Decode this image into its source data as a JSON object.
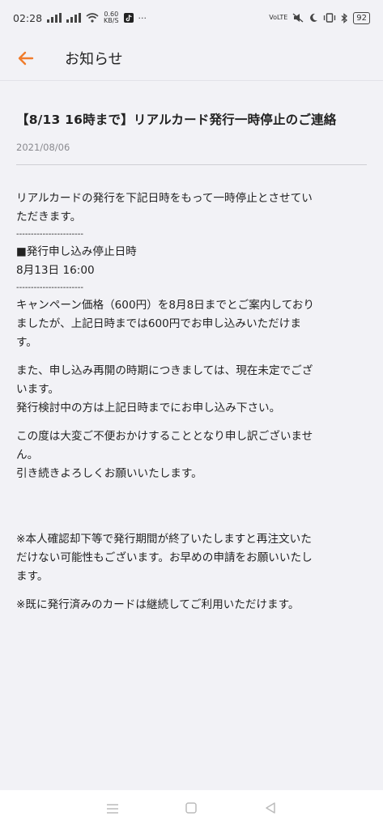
{
  "status_bar": {
    "time": "02:28",
    "speed_value": "0.60",
    "speed_unit": "KB/S",
    "more": "···",
    "network_label": "VoLTE",
    "battery": "92"
  },
  "header": {
    "title": "お知らせ"
  },
  "post": {
    "title": "【8/13 16時まで】リアルカード発行一時停止のご連絡",
    "date": "2021/08/06",
    "p1": [
      "リアルカードの発行を下記日時をもって一時停止とさせてい",
      "ただきます。"
    ],
    "separator1": "-----------------------",
    "section_heading": "■発行申し込み停止日時",
    "section_value": "8月13日 16:00",
    "separator2": "-----------------------",
    "p2": [
      "キャンペーン価格（600円）を8月8日までとご案内しており",
      "ましたが、上記日時までは600円でお申し込みいただけま",
      "す。"
    ],
    "p3": [
      "また、申し込み再開の時期につきましては、現在未定でござ",
      "います。",
      "発行検討中の方は上記日時までにお申し込み下さい。"
    ],
    "p4": [
      "この度は大変ご不便おかけすることとなり申し訳ございませ",
      "ん。",
      "引き続きよろしくお願いいたします。"
    ],
    "note1": [
      "※本人確認却下等で発行期間が終了いたしますと再注文いた",
      "だけない可能性もございます。お早めの申請をお願いいたし",
      "ます。"
    ],
    "note2": [
      "※既に発行済みのカードは継続してご利用いただけます。"
    ]
  },
  "colors": {
    "accent": "#f07c2c",
    "background": "#f2f2f6"
  },
  "icons": {
    "back": "arrow-left-icon",
    "nav_menu": "menu-icon",
    "nav_home": "square-home-icon",
    "nav_back": "triangle-back-icon"
  }
}
